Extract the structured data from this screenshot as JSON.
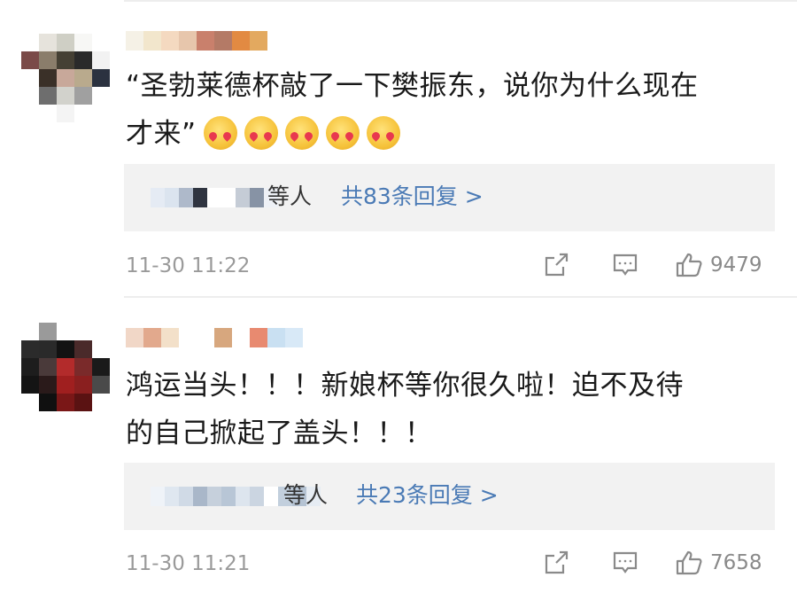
{
  "comments": [
    {
      "text_line1": "“圣勃莱德杯敲了一下樊振东，说你为什么现在",
      "text_line2": "才来”",
      "emoji_count": 5,
      "emoji_icon": "blushing-heart-face-emoji",
      "reply_etc": "等人",
      "reply_count": "共83条回复 >",
      "time": "11-30 11:22",
      "likes": "9479",
      "avatar_colors": [
        "#ffffff",
        "#e6e3dc",
        "#cfcfc5",
        "#f7f7f5",
        "#ffffff",
        "#7a4a48",
        "#8a7d6b",
        "#454034",
        "#2a2a2a",
        "#f2f2f2",
        "#ffffff",
        "#3a3028",
        "#c8a89a",
        "#b9aa8d",
        "#2b3240",
        "#ffffff",
        "#6e6e6e",
        "#d2d2cc",
        "#a0a0a0",
        "#ffffff",
        "#ffffff",
        "#ffffff",
        "#f4f4f4",
        "#ffffff",
        "#ffffff"
      ],
      "username_colors": [
        "#f5f1e6",
        "#f2e6cc",
        "#f4d9c0",
        "#e7c6ac",
        "#c9806c",
        "#b47a66",
        "#e28a42",
        "#e3a95f"
      ],
      "reply_user_colors": [
        "#e5ebf4",
        "#dbe4ef",
        "#aeb9ca",
        "#2f3440",
        "#ffffff",
        "#ffffff",
        "#c5ccd6",
        "#8793a5",
        "#eef1f6"
      ]
    },
    {
      "text_line1": "鸿运当头！！！新娘杯等你很久啦！迫不及待",
      "text_line2": "的自己掀起了盖头！！！",
      "emoji_count": 0,
      "reply_etc": "等人",
      "reply_count": "共23条回复 >",
      "time": "11-30 11:21",
      "likes": "7658",
      "avatar_colors": [
        "#ffffff",
        "#9a9a9a",
        "#ffffff",
        "#ffffff",
        "#ffffff",
        "#2b2b2b",
        "#2a2a2a",
        "#121212",
        "#4a2a2a",
        "#ffffff",
        "#1d1d1d",
        "#4a3a3a",
        "#b32b2b",
        "#7a2a2a",
        "#1a1a1a",
        "#141414",
        "#2a1a1a",
        "#a01f1f",
        "#8a1f1f",
        "#4a4a4a",
        "#ffffff",
        "#101010",
        "#7a1717",
        "#5a1212",
        "#ffffff"
      ],
      "username_colors": [
        "#f1d7c7",
        "#e2a98d",
        "#f3e0c9",
        "#ffffff",
        "#ffffff",
        "#d7a77e",
        "#ffffff",
        "#e88a70",
        "#c9e0f2",
        "#d8e9f7"
      ],
      "reply_user_colors": [
        "#eff3f8",
        "#dfe7f0",
        "#d0dae6",
        "#a9b7c9",
        "#c6d0dc",
        "#b8c6d6",
        "#dde5ee",
        "#cbd5e1",
        "#ffffff",
        "#c2cfdd",
        "#b5c3d3",
        "#e6ecf3"
      ]
    }
  ],
  "icons": {
    "share": "share-icon",
    "comment": "comment-icon",
    "like": "thumbs-up-icon"
  },
  "colors": {
    "link": "#4a7ab5",
    "text": "#1a1a1a",
    "meta": "#9a9a9a",
    "reply_bg": "#f2f2f2",
    "divider": "#ededed"
  }
}
